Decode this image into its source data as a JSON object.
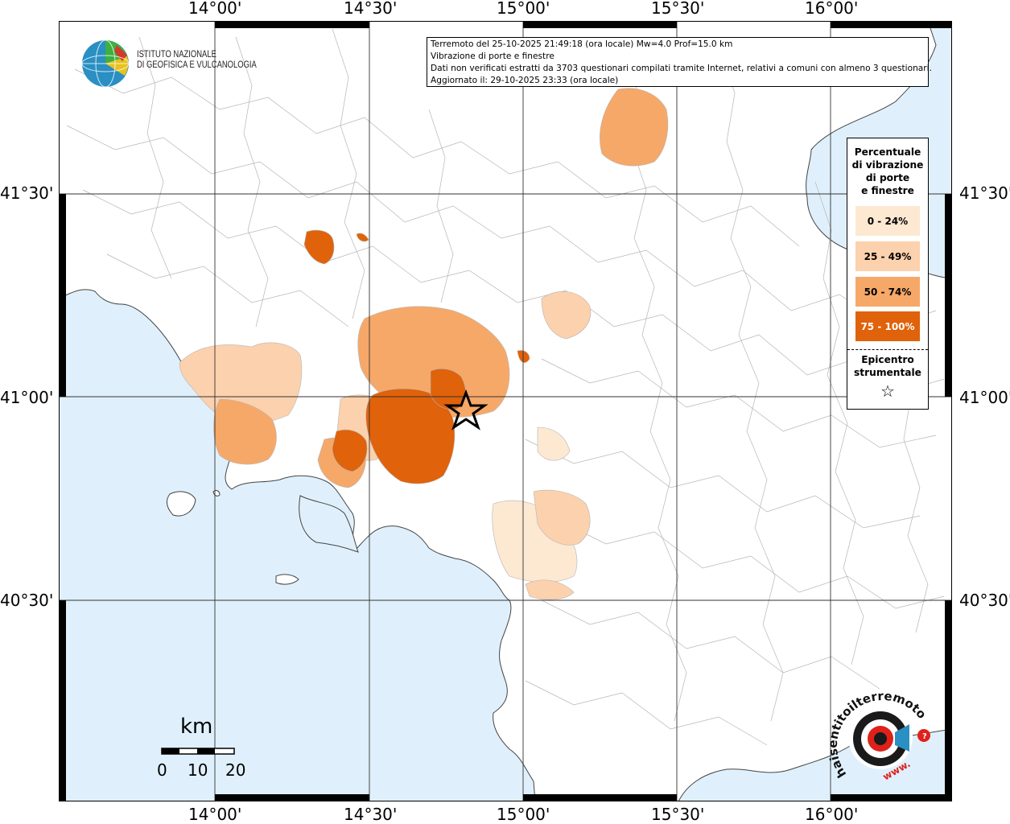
{
  "map": {
    "lon_labels": [
      "14°00'",
      "14°30'",
      "15°00'",
      "15°30'",
      "16°00'"
    ],
    "lat_labels": [
      "41°30'",
      "41°00'",
      "40°30'"
    ],
    "epicenter_icon": "star-icon",
    "colors": {
      "sea": "#dff0fc",
      "land": "#ffffff",
      "borders": "#9a9a9a",
      "class_0_24": "#fde8d2",
      "class_25_49": "#fcd1ad",
      "class_50_74": "#f6a869",
      "class_75_100": "#e0620b"
    }
  },
  "info": {
    "line1": "Terremoto del 25-10-2025 21:49:18 (ora locale) Mw=4.0 Prof=15.0 km",
    "line2": "Vibrazione di porte e finestre",
    "line3": "Dati non verificati estratti da 3703 questionari compilati tramite Internet, relativi a comuni con almeno 3 questionari.",
    "line4": "Aggiornato il: 29-10-2025 23:33 (ora locale)"
  },
  "legend": {
    "title_lines": [
      "Percentuale",
      "di vibrazione",
      "di porte",
      "e finestre"
    ],
    "classes": [
      "0 - 24%",
      "25 - 49%",
      "50 - 74%",
      "75 - 100%"
    ],
    "epicenter_lines": [
      "Epicentro",
      "strumentale"
    ],
    "epicenter_symbol": "☆"
  },
  "logo": {
    "org_line1": "ISTITUTO NAZIONALE",
    "org_line2": "DI GEOFISICA E VULCANOLOGIA",
    "site_text": "haisentitoilterremoto.it",
    "site_prefix": "www."
  },
  "scale": {
    "unit": "km",
    "ticks": [
      "0",
      "10",
      "20"
    ]
  }
}
